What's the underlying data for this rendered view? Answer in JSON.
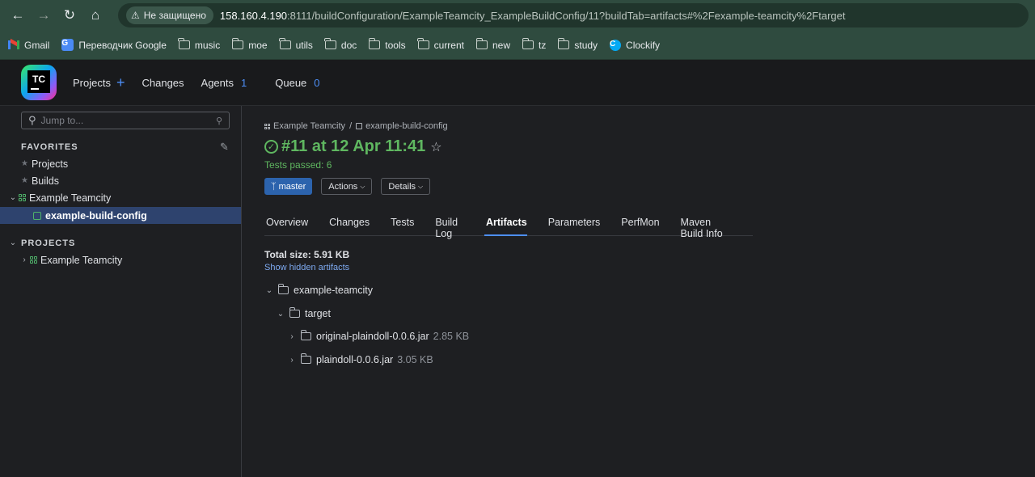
{
  "browser": {
    "security_label": "Не защищено",
    "url_host": "158.160.4.190",
    "url_rest": ":8111/buildConfiguration/ExampleTeamcity_ExampleBuildConfig/11?buildTab=artifacts#%2Fexample-teamcity%2Ftarget",
    "bookmarks": [
      {
        "label": "Gmail",
        "icon": "gmail-icon"
      },
      {
        "label": "Переводчик Google",
        "icon": "google-translate-icon"
      },
      {
        "label": "music",
        "icon": "folder-icon"
      },
      {
        "label": "moe",
        "icon": "folder-icon"
      },
      {
        "label": "utils",
        "icon": "folder-icon"
      },
      {
        "label": "doc",
        "icon": "folder-icon"
      },
      {
        "label": "tools",
        "icon": "folder-icon"
      },
      {
        "label": "current",
        "icon": "folder-icon"
      },
      {
        "label": "new",
        "icon": "folder-icon"
      },
      {
        "label": "tz",
        "icon": "folder-icon"
      },
      {
        "label": "study",
        "icon": "folder-icon"
      },
      {
        "label": "Clockify",
        "icon": "clockify-icon"
      }
    ]
  },
  "header": {
    "logo_text": "TC",
    "projects": "Projects",
    "changes": "Changes",
    "agents": "Agents",
    "agents_count": "1",
    "queue": "Queue",
    "queue_count": "0"
  },
  "sidebar": {
    "search_placeholder": "Jump to...",
    "favorites_title": "FAVORITES",
    "favorites": {
      "projects": "Projects",
      "builds": "Builds",
      "project": "Example Teamcity",
      "config": "example-build-config"
    },
    "projects_title": "PROJECTS",
    "projects_item": "Example Teamcity"
  },
  "build": {
    "breadcrumb_project": "Example Teamcity",
    "breadcrumb_sep": "/",
    "breadcrumb_config": "example-build-config",
    "title": "#11 at 12 Apr 11:41",
    "tests": "Tests passed: 6",
    "branch": "master",
    "actions": "Actions",
    "details": "Details",
    "tabs": [
      "Overview",
      "Changes",
      "Tests",
      "Build Log",
      "Artifacts",
      "Parameters",
      "PerfMon",
      "Maven Build Info"
    ],
    "active_tab": "Artifacts",
    "total_size": "Total size: 5.91 KB",
    "show_hidden": "Show hidden artifacts",
    "artifacts": {
      "root": "example-teamcity",
      "folder": "target",
      "files": [
        {
          "name": "original-plaindoll-0.0.6.jar",
          "size": "2.85 KB"
        },
        {
          "name": "plaindoll-0.0.6.jar",
          "size": "3.05 KB"
        }
      ]
    }
  },
  "colors": {
    "success": "#5fb760",
    "accent": "#4d8ff7",
    "branch_bg": "#2c63ad",
    "chrome": "#2f4b3f"
  }
}
